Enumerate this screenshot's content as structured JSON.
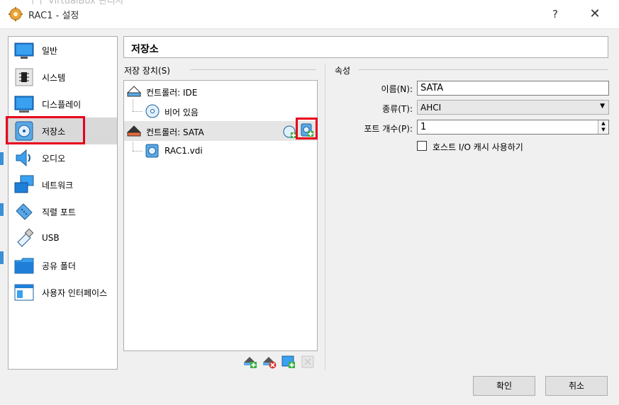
{
  "window": {
    "title": "RAC1 - 설정",
    "background_title": "ㅣㅏ VirtualBox 관리자",
    "help_symbol": "?",
    "close_symbol": "✕"
  },
  "categories": [
    {
      "label": "일반",
      "icon": "general-icon",
      "selected": false
    },
    {
      "label": "시스템",
      "icon": "system-icon",
      "selected": false
    },
    {
      "label": "디스플레이",
      "icon": "display-icon",
      "selected": false
    },
    {
      "label": "저장소",
      "icon": "storage-icon",
      "selected": true
    },
    {
      "label": "오디오",
      "icon": "audio-icon",
      "selected": false
    },
    {
      "label": "네트워크",
      "icon": "network-icon",
      "selected": false
    },
    {
      "label": "직렬 포트",
      "icon": "serial-port-icon",
      "selected": false
    },
    {
      "label": "USB",
      "icon": "usb-icon",
      "selected": false
    },
    {
      "label": "공유 폴더",
      "icon": "shared-folder-icon",
      "selected": false
    },
    {
      "label": "사용자 인터페이스",
      "icon": "user-interface-icon",
      "selected": false
    }
  ],
  "section_title": "저장소",
  "storage": {
    "group_label": "저장 장치(S)",
    "tree": [
      {
        "label": "컨트롤러: IDE",
        "type": "controller",
        "icon": "ide-controller-icon"
      },
      {
        "label": "비어 있음",
        "type": "optical",
        "icon": "cd-icon"
      },
      {
        "label": "컨트롤러: SATA",
        "type": "controller",
        "icon": "sata-controller-icon",
        "selected": true
      },
      {
        "label": "RAC1.vdi",
        "type": "disk",
        "icon": "hard-disk-icon"
      }
    ]
  },
  "attributes": {
    "group_label": "속성",
    "name_label": "이름(N):",
    "name_value": "SATA",
    "type_label": "종류(T):",
    "type_value": "AHCI",
    "ports_label": "포트 개수(P):",
    "ports_value": "1",
    "host_io_cache_label": "호스트 I/O 캐시 사용하기",
    "host_io_cache_checked": false
  },
  "buttons": {
    "ok": "확인",
    "cancel": "취소"
  },
  "colors": {
    "highlight_red": "#e8001c",
    "selected_bg": "#d9d9d9",
    "accent_blue": "#2f7fd1"
  }
}
